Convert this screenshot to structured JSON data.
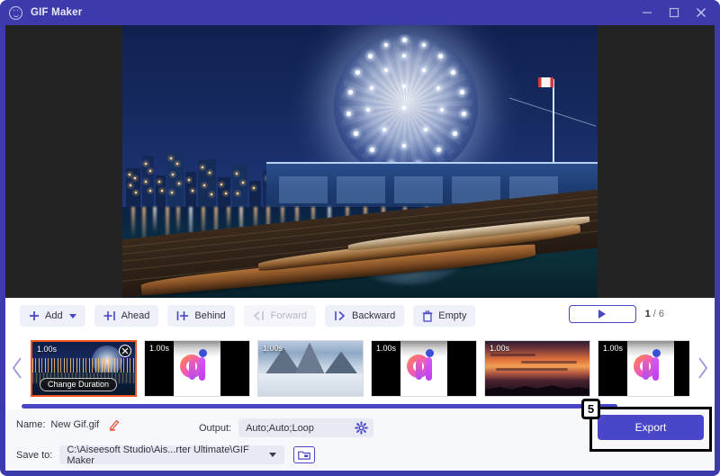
{
  "window": {
    "title": "GIF Maker",
    "app_icon": "smiley-circle-icon",
    "minimize": "minimize-icon",
    "maximize": "maximize-icon",
    "close": "close-icon",
    "accent": "#3d3bab"
  },
  "preview": {
    "name": "preview-stage",
    "description": "Science World dome Vancouver at night with boats on water"
  },
  "toolbar": {
    "add_label": "Add",
    "ahead_label": "Ahead",
    "behind_label": "Behind",
    "forward_label": "Forward",
    "backward_label": "Backward",
    "empty_label": "Empty",
    "play_label": "play-icon",
    "counter_current": "1",
    "counter_sep": "/",
    "counter_total": "6"
  },
  "filmstrip": {
    "prev_arrow": "chevron-left-icon",
    "next_arrow": "chevron-right-icon",
    "change_duration_label": "Change Duration",
    "frames": [
      {
        "duration": "1.00s",
        "kind": "night",
        "selected": true
      },
      {
        "duration": "1.00s",
        "kind": "ai",
        "selected": false
      },
      {
        "duration": "1.00s",
        "kind": "snow",
        "selected": false
      },
      {
        "duration": "1.00s",
        "kind": "ai",
        "selected": false
      },
      {
        "duration": "1.00s",
        "kind": "sunset",
        "selected": false
      },
      {
        "duration": "1.00s",
        "kind": "ai",
        "selected": false
      }
    ]
  },
  "form": {
    "name_label": "Name:",
    "name_value": "New Gif.gif",
    "edit_icon": "pencil-icon",
    "output_label": "Output:",
    "output_value": "Auto;Auto;Loop",
    "settings_icon": "gear-icon",
    "save_label": "Save to:",
    "save_path": "C:\\Aiseesoft Studio\\Ais...rter Ultimate\\GIF Maker",
    "browse_icon": "folder-icon"
  },
  "export": {
    "label": "Export",
    "step_number": "5",
    "highlight_color": "#000000",
    "button_color": "#4a46c8"
  }
}
